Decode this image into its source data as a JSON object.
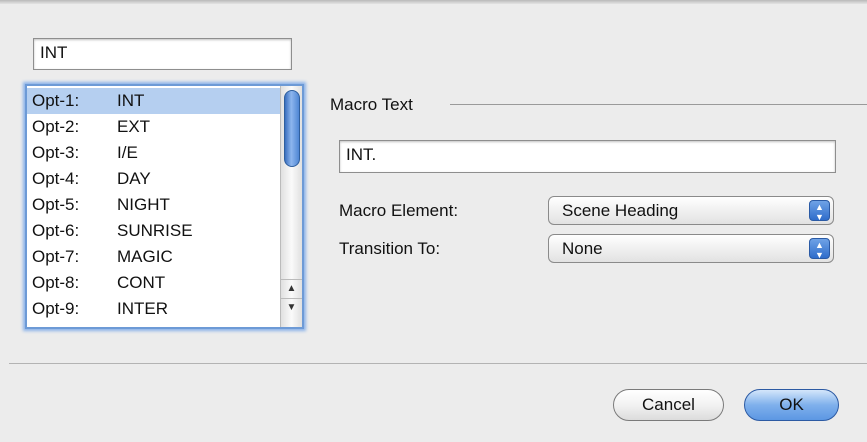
{
  "name_field": {
    "value": "INT"
  },
  "macro_list": {
    "selected_index": 0,
    "items": [
      {
        "key": "Opt-1:",
        "value": "INT"
      },
      {
        "key": "Opt-2:",
        "value": "EXT"
      },
      {
        "key": "Opt-3:",
        "value": "I/E"
      },
      {
        "key": "Opt-4:",
        "value": "DAY"
      },
      {
        "key": "Opt-5:",
        "value": "NIGHT"
      },
      {
        "key": "Opt-6:",
        "value": "SUNRISE"
      },
      {
        "key": "Opt-7:",
        "value": "MAGIC"
      },
      {
        "key": "Opt-8:",
        "value": "CONT"
      },
      {
        "key": "Opt-9:",
        "value": "INTER"
      }
    ]
  },
  "macro_text": {
    "title": "Macro Text",
    "value": "INT."
  },
  "macro_element": {
    "label": "Macro Element:",
    "value": "Scene Heading"
  },
  "transition_to": {
    "label": "Transition To:",
    "value": "None"
  },
  "buttons": {
    "cancel": "Cancel",
    "ok": "OK"
  },
  "icons": {
    "scroll_up": "up-arrow-icon",
    "scroll_down": "down-arrow-icon",
    "popup": "up-down-stepper-icon"
  },
  "colors": {
    "selection": "#b5cff0",
    "focus_ring": "#6d9ad6",
    "default_button": "#7fb0ec"
  }
}
